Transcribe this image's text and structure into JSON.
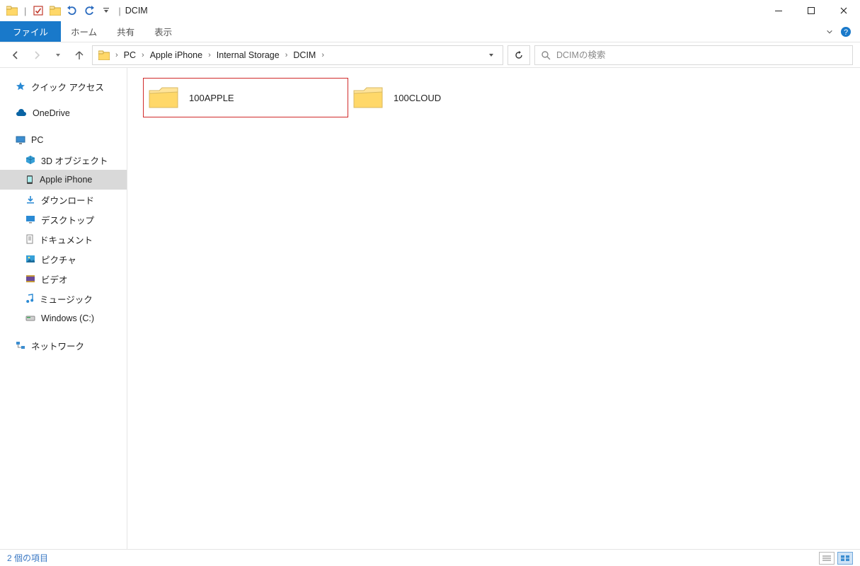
{
  "window": {
    "title": "DCIM"
  },
  "ribbon": {
    "file": "ファイル",
    "tabs": [
      "ホーム",
      "共有",
      "表示"
    ]
  },
  "breadcrumbs": [
    "PC",
    "Apple iPhone",
    "Internal Storage",
    "DCIM"
  ],
  "search": {
    "placeholder": "DCIMの検索"
  },
  "sidebar": {
    "quick_access": "クイック アクセス",
    "onedrive": "OneDrive",
    "pc": "PC",
    "pc_children": [
      "3D オブジェクト",
      "Apple iPhone",
      "ダウンロード",
      "デスクトップ",
      "ドキュメント",
      "ピクチャ",
      "ビデオ",
      "ミュージック",
      "Windows (C:)"
    ],
    "network": "ネットワーク",
    "selected": "Apple iPhone"
  },
  "items": [
    {
      "name": "100APPLE",
      "highlighted": true
    },
    {
      "name": "100CLOUD",
      "highlighted": false
    }
  ],
  "status": {
    "text": "2 個の項目"
  }
}
